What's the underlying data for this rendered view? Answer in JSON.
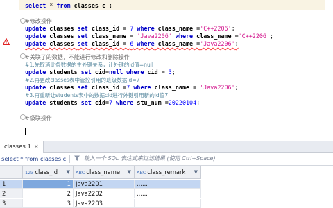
{
  "editor": {
    "lines": {
      "l1": {
        "kw1": "select",
        "rest": " * ",
        "kw2": "from",
        "tbl": " classes c ",
        "end": ";"
      },
      "l2": {
        "comment": "#修改操作"
      },
      "l3": {
        "a": "update",
        "b": " classes ",
        "c": "set",
        "d": " class_id = ",
        "e": "7",
        "f": " where",
        "g": " class_name =",
        "h": "'C++2206'",
        "i": ";"
      },
      "l4": {
        "a": "update",
        "b": " classes ",
        "c": "set",
        "d": " class_name = ",
        "e": "'Java2206'",
        "f": " where",
        "g": " class_name =",
        "h": "'C++2206'",
        "i": ";"
      },
      "l5": {
        "a": "update",
        "b": " classes ",
        "c": "set",
        "d": " class_id = ",
        "e": "6",
        "f": " where",
        "g": " class_name =",
        "h": "'Java2206'",
        "i": ";"
      },
      "l6": {
        "comment": "#关联了的数据，不能进行修改和删除操作"
      },
      "l7": {
        "comment": "#1.先取消此条数据的主外键关系，让外键的id值=null"
      },
      "l8": {
        "a": "update",
        "b": " students ",
        "c": "set",
        "d": " cid=",
        "e": "null",
        "f": " where",
        "g": " cid = ",
        "h": "3",
        "i": ";"
      },
      "l9": {
        "comment": "#2.再更改classes表中管控引用的班级数据id=7"
      },
      "l10": {
        "a": "update",
        "b": " classes ",
        "c": "set",
        "d": " class_id =",
        "e": "7",
        "f": " where",
        "g": " class_name = ",
        "h": "'Java2206'",
        "i": ";"
      },
      "l11": {
        "comment": "#3.再重新让students表中的数据cid进行外键引用新的id值7"
      },
      "l12": {
        "a": "update",
        "b": " students ",
        "c": "set",
        "d": " cid=",
        "e": "7",
        "f": " where",
        "g": " stu_num =",
        "h": "20220104",
        "i": ";"
      },
      "l13": {
        "comment": "#级联操作"
      }
    }
  },
  "results": {
    "tab_label": "classes 1",
    "tab_close": "✕",
    "query_text": "select * from classes c",
    "filter_placeholder": "输入一个 SQL 表达式来过滤结果 (使用 Ctrl+Space)",
    "columns": [
      {
        "name": "class_id",
        "type_icon": "123"
      },
      {
        "name": "class_name",
        "type_icon": "ABC"
      },
      {
        "name": "class_remark",
        "type_icon": "ABC"
      }
    ],
    "rows": [
      {
        "n": "1",
        "class_id": "1",
        "class_name": "Java2201",
        "class_remark": "......"
      },
      {
        "n": "2",
        "class_id": "2",
        "class_name": "Java2202",
        "class_remark": "......"
      },
      {
        "n": "3",
        "class_id": "3",
        "class_name": "Java2203",
        "class_remark": ""
      }
    ]
  },
  "colors": {
    "keyword": "#0000c8",
    "string": "#d2148c",
    "selection": "#c3d6f2",
    "warning": "#e02020"
  }
}
